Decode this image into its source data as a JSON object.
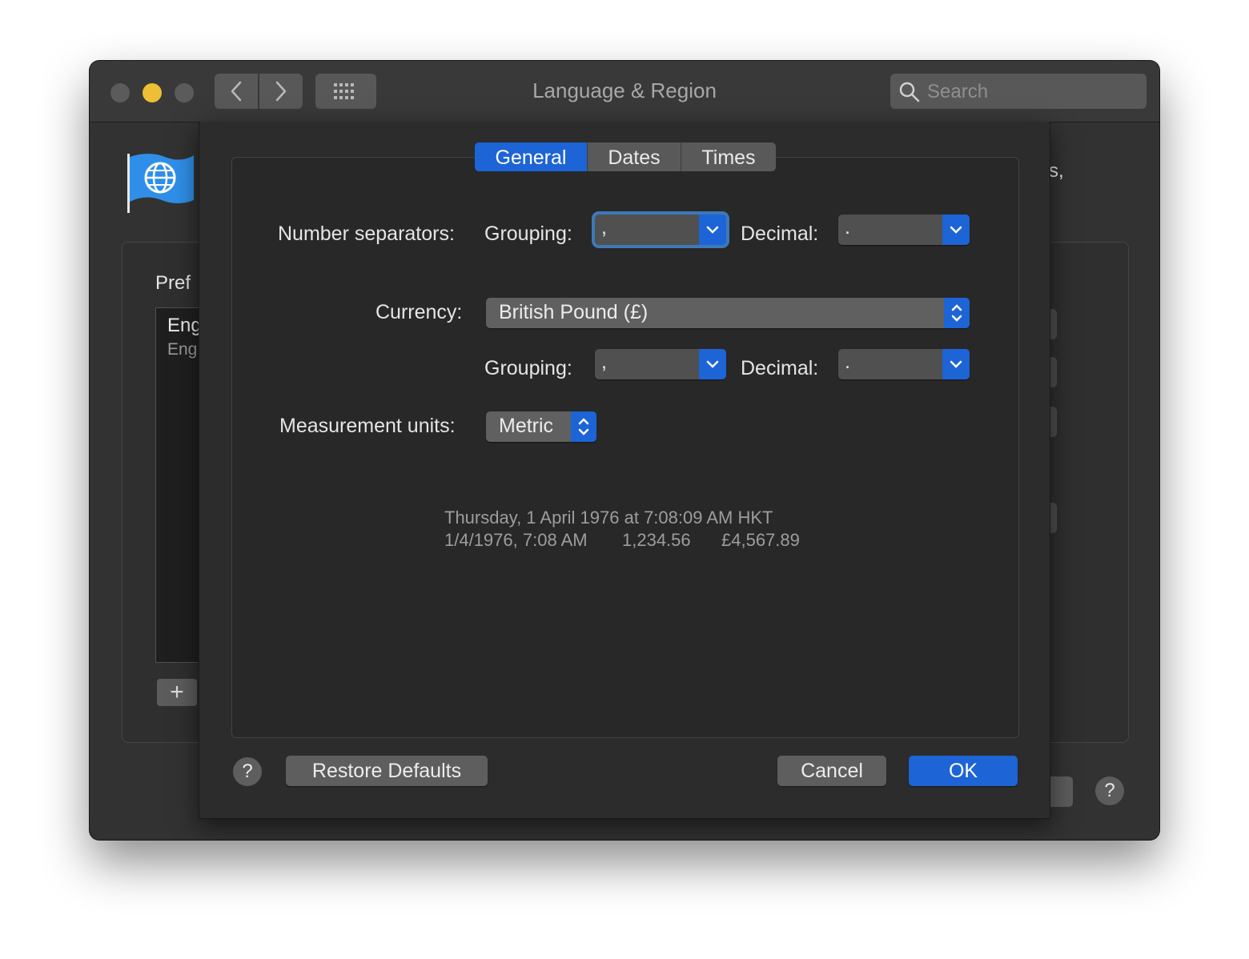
{
  "window": {
    "title": "Language & Region",
    "search_placeholder": "Search"
  },
  "background": {
    "preferred_label_partial": "Pref",
    "list_item_1": "Eng",
    "list_item_2": "Eng",
    "trailing_text": "s,",
    "add_label": "+",
    "help_label": "?"
  },
  "sheet": {
    "tabs": [
      "General",
      "Dates",
      "Times"
    ],
    "active_tab": "General",
    "number_separators_label": "Number separators:",
    "grouping_label": "Grouping:",
    "decimal_label": "Decimal:",
    "number_grouping_value": ",",
    "number_decimal_value": ".",
    "currency_label": "Currency:",
    "currency_value": "British Pound (£)",
    "currency_grouping_value": ",",
    "currency_decimal_value": ".",
    "measurement_label": "Measurement units:",
    "measurement_value": "Metric",
    "sample_line1": "Thursday, 1 April 1976 at 7:08:09 AM HKT",
    "sample_date": "1/4/1976, 7:08 AM",
    "sample_number": "1,234.56",
    "sample_currency": "£4,567.89",
    "help_label": "?",
    "restore_label": "Restore Defaults",
    "cancel_label": "Cancel",
    "ok_label": "OK"
  },
  "colors": {
    "accent": "#1d64d6",
    "window_bg": "#323232",
    "sheet_bg": "#2c2c2c"
  }
}
